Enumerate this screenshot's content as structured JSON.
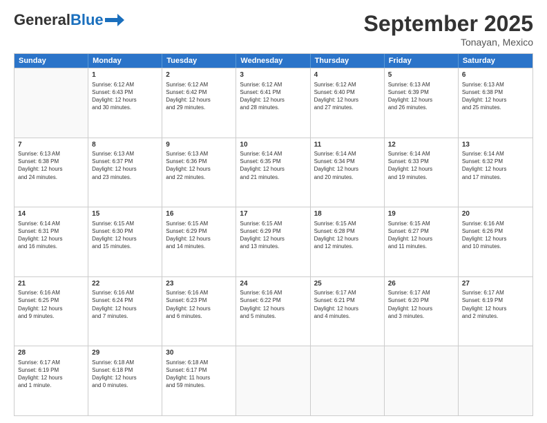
{
  "header": {
    "logo_general": "General",
    "logo_blue": "Blue",
    "month": "September 2025",
    "location": "Tonayan, Mexico"
  },
  "days_of_week": [
    "Sunday",
    "Monday",
    "Tuesday",
    "Wednesday",
    "Thursday",
    "Friday",
    "Saturday"
  ],
  "weeks": [
    [
      {
        "day": "",
        "info": ""
      },
      {
        "day": "1",
        "info": "Sunrise: 6:12 AM\nSunset: 6:43 PM\nDaylight: 12 hours\nand 30 minutes."
      },
      {
        "day": "2",
        "info": "Sunrise: 6:12 AM\nSunset: 6:42 PM\nDaylight: 12 hours\nand 29 minutes."
      },
      {
        "day": "3",
        "info": "Sunrise: 6:12 AM\nSunset: 6:41 PM\nDaylight: 12 hours\nand 28 minutes."
      },
      {
        "day": "4",
        "info": "Sunrise: 6:12 AM\nSunset: 6:40 PM\nDaylight: 12 hours\nand 27 minutes."
      },
      {
        "day": "5",
        "info": "Sunrise: 6:13 AM\nSunset: 6:39 PM\nDaylight: 12 hours\nand 26 minutes."
      },
      {
        "day": "6",
        "info": "Sunrise: 6:13 AM\nSunset: 6:38 PM\nDaylight: 12 hours\nand 25 minutes."
      }
    ],
    [
      {
        "day": "7",
        "info": "Sunrise: 6:13 AM\nSunset: 6:38 PM\nDaylight: 12 hours\nand 24 minutes."
      },
      {
        "day": "8",
        "info": "Sunrise: 6:13 AM\nSunset: 6:37 PM\nDaylight: 12 hours\nand 23 minutes."
      },
      {
        "day": "9",
        "info": "Sunrise: 6:13 AM\nSunset: 6:36 PM\nDaylight: 12 hours\nand 22 minutes."
      },
      {
        "day": "10",
        "info": "Sunrise: 6:14 AM\nSunset: 6:35 PM\nDaylight: 12 hours\nand 21 minutes."
      },
      {
        "day": "11",
        "info": "Sunrise: 6:14 AM\nSunset: 6:34 PM\nDaylight: 12 hours\nand 20 minutes."
      },
      {
        "day": "12",
        "info": "Sunrise: 6:14 AM\nSunset: 6:33 PM\nDaylight: 12 hours\nand 19 minutes."
      },
      {
        "day": "13",
        "info": "Sunrise: 6:14 AM\nSunset: 6:32 PM\nDaylight: 12 hours\nand 17 minutes."
      }
    ],
    [
      {
        "day": "14",
        "info": "Sunrise: 6:14 AM\nSunset: 6:31 PM\nDaylight: 12 hours\nand 16 minutes."
      },
      {
        "day": "15",
        "info": "Sunrise: 6:15 AM\nSunset: 6:30 PM\nDaylight: 12 hours\nand 15 minutes."
      },
      {
        "day": "16",
        "info": "Sunrise: 6:15 AM\nSunset: 6:29 PM\nDaylight: 12 hours\nand 14 minutes."
      },
      {
        "day": "17",
        "info": "Sunrise: 6:15 AM\nSunset: 6:29 PM\nDaylight: 12 hours\nand 13 minutes."
      },
      {
        "day": "18",
        "info": "Sunrise: 6:15 AM\nSunset: 6:28 PM\nDaylight: 12 hours\nand 12 minutes."
      },
      {
        "day": "19",
        "info": "Sunrise: 6:15 AM\nSunset: 6:27 PM\nDaylight: 12 hours\nand 11 minutes."
      },
      {
        "day": "20",
        "info": "Sunrise: 6:16 AM\nSunset: 6:26 PM\nDaylight: 12 hours\nand 10 minutes."
      }
    ],
    [
      {
        "day": "21",
        "info": "Sunrise: 6:16 AM\nSunset: 6:25 PM\nDaylight: 12 hours\nand 9 minutes."
      },
      {
        "day": "22",
        "info": "Sunrise: 6:16 AM\nSunset: 6:24 PM\nDaylight: 12 hours\nand 7 minutes."
      },
      {
        "day": "23",
        "info": "Sunrise: 6:16 AM\nSunset: 6:23 PM\nDaylight: 12 hours\nand 6 minutes."
      },
      {
        "day": "24",
        "info": "Sunrise: 6:16 AM\nSunset: 6:22 PM\nDaylight: 12 hours\nand 5 minutes."
      },
      {
        "day": "25",
        "info": "Sunrise: 6:17 AM\nSunset: 6:21 PM\nDaylight: 12 hours\nand 4 minutes."
      },
      {
        "day": "26",
        "info": "Sunrise: 6:17 AM\nSunset: 6:20 PM\nDaylight: 12 hours\nand 3 minutes."
      },
      {
        "day": "27",
        "info": "Sunrise: 6:17 AM\nSunset: 6:19 PM\nDaylight: 12 hours\nand 2 minutes."
      }
    ],
    [
      {
        "day": "28",
        "info": "Sunrise: 6:17 AM\nSunset: 6:19 PM\nDaylight: 12 hours\nand 1 minute."
      },
      {
        "day": "29",
        "info": "Sunrise: 6:18 AM\nSunset: 6:18 PM\nDaylight: 12 hours\nand 0 minutes."
      },
      {
        "day": "30",
        "info": "Sunrise: 6:18 AM\nSunset: 6:17 PM\nDaylight: 11 hours\nand 59 minutes."
      },
      {
        "day": "",
        "info": ""
      },
      {
        "day": "",
        "info": ""
      },
      {
        "day": "",
        "info": ""
      },
      {
        "day": "",
        "info": ""
      }
    ]
  ]
}
